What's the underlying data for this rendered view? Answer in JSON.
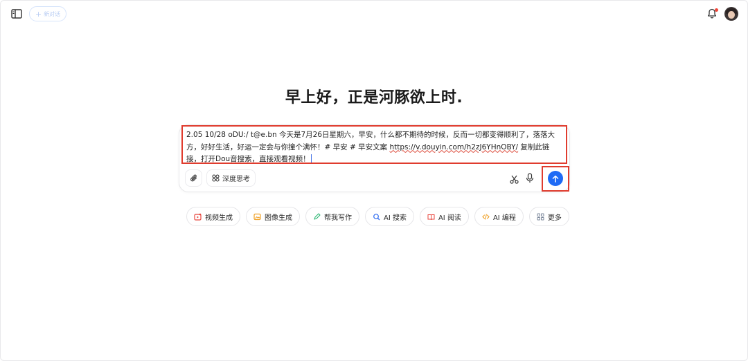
{
  "topbar": {
    "new_chat_label": "新对话",
    "sidebar_icon": "sidebar-toggle-icon",
    "bell_icon": "bell-icon"
  },
  "greeting": "早上好，正是河豚欲上时.",
  "input": {
    "text_part1": "2.05 10/28 oDU:/ t@e.bn 今天是7月26日星期六，早安，什么都不期待的时候，反而一切都变得顺利了，落落大方，好好生活，好运一定会与你撞个满怀！# 早安 # 早安文案 ",
    "link": "https://v.douyin.com/h2zJ6YHnOBY/",
    "text_part2": " 复制此链接，打开Dou音搜索，直接观看视频！"
  },
  "toolbar": {
    "deep_think_label": "深度思考",
    "attach_icon": "paperclip-icon",
    "scissors_icon": "scissors-icon",
    "mic_icon": "microphone-icon",
    "send_icon": "arrow-up-icon"
  },
  "chips": [
    {
      "label": "视频生成",
      "icon": "video-icon",
      "color": "#e8453c"
    },
    {
      "label": "图像生成",
      "icon": "image-icon",
      "color": "#f0a024"
    },
    {
      "label": "帮我写作",
      "icon": "pen-icon",
      "color": "#2bb673"
    },
    {
      "label": "AI 搜索",
      "icon": "search-icon",
      "color": "#2f6bf0"
    },
    {
      "label": "AI 阅读",
      "icon": "book-icon",
      "color": "#e8453c"
    },
    {
      "label": "AI 编程",
      "icon": "code-icon",
      "color": "#f0a024"
    },
    {
      "label": "更多",
      "icon": "grid-icon",
      "color": "#7a8699"
    }
  ],
  "colors": {
    "accent": "#1f6bf5",
    "highlight_box": "#e03c2e"
  }
}
